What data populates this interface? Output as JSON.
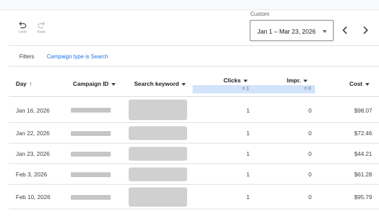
{
  "toolbar": {
    "undo_label": "Undo",
    "redo_label": "Redo"
  },
  "date_range": {
    "caption": "Custom",
    "value": "Jan 1 – Mar 23, 2026"
  },
  "filters": {
    "label": "Filters",
    "chip": "Campaign type is Search"
  },
  "table": {
    "headers": {
      "day": "Day",
      "campaign_id": "Campaign ID",
      "keyword": "Search keyword",
      "clicks": "Clicks",
      "impr": "Impr.",
      "cost": "Cost"
    },
    "header_filters": {
      "clicks": "= 1",
      "impr": "= 0"
    },
    "rows": [
      {
        "day": "Jan 16, 2026",
        "clicks": "1",
        "impr": "0",
        "cost": "$98.07"
      },
      {
        "day": "Jan 22, 2026",
        "clicks": "1",
        "impr": "0",
        "cost": "$72.46"
      },
      {
        "day": "Jan 23, 2026",
        "clicks": "1",
        "impr": "0",
        "cost": "$44.21"
      },
      {
        "day": "Feb 3, 2026",
        "clicks": "1",
        "impr": "0",
        "cost": "$61.28"
      },
      {
        "day": "Feb 10, 2026",
        "clicks": "1",
        "impr": "0",
        "cost": "$95.79"
      }
    ]
  },
  "icons": {
    "undo": "undo-icon",
    "redo": "redo-icon",
    "prev": "chevron-left-icon",
    "next": "chevron-right-icon",
    "sort_asc": "arrow-up-icon",
    "sort_menu": "caret-down-icon"
  },
  "colors": {
    "accent": "#1a73e8",
    "filter_highlight": "#d2e3fc",
    "redaction": "#c6c6c6"
  }
}
